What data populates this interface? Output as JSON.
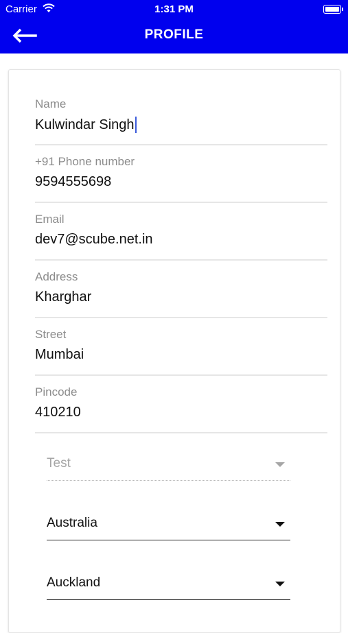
{
  "status_bar": {
    "carrier": "Carrier",
    "time": "1:31 PM"
  },
  "header": {
    "title": "PROFILE",
    "back_icon": "arrow-left-icon"
  },
  "form": {
    "fields": [
      {
        "label": "Name",
        "value": "Kulwindar Singh"
      },
      {
        "label": "+91 Phone number",
        "value": "9594555698"
      },
      {
        "label": "Email",
        "value": "dev7@scube.net.in"
      },
      {
        "label": "Address",
        "value": "Kharghar"
      },
      {
        "label": "Street",
        "value": "Mumbai"
      },
      {
        "label": "Pincode",
        "value": "410210"
      }
    ],
    "selects": [
      {
        "value": "Test",
        "disabled": true
      },
      {
        "value": "Australia",
        "disabled": false
      },
      {
        "value": "Auckland",
        "disabled": false
      }
    ]
  },
  "colors": {
    "header_bg": "#0000ee",
    "label": "#8c8c8c",
    "caret": "#3b5bdb"
  }
}
